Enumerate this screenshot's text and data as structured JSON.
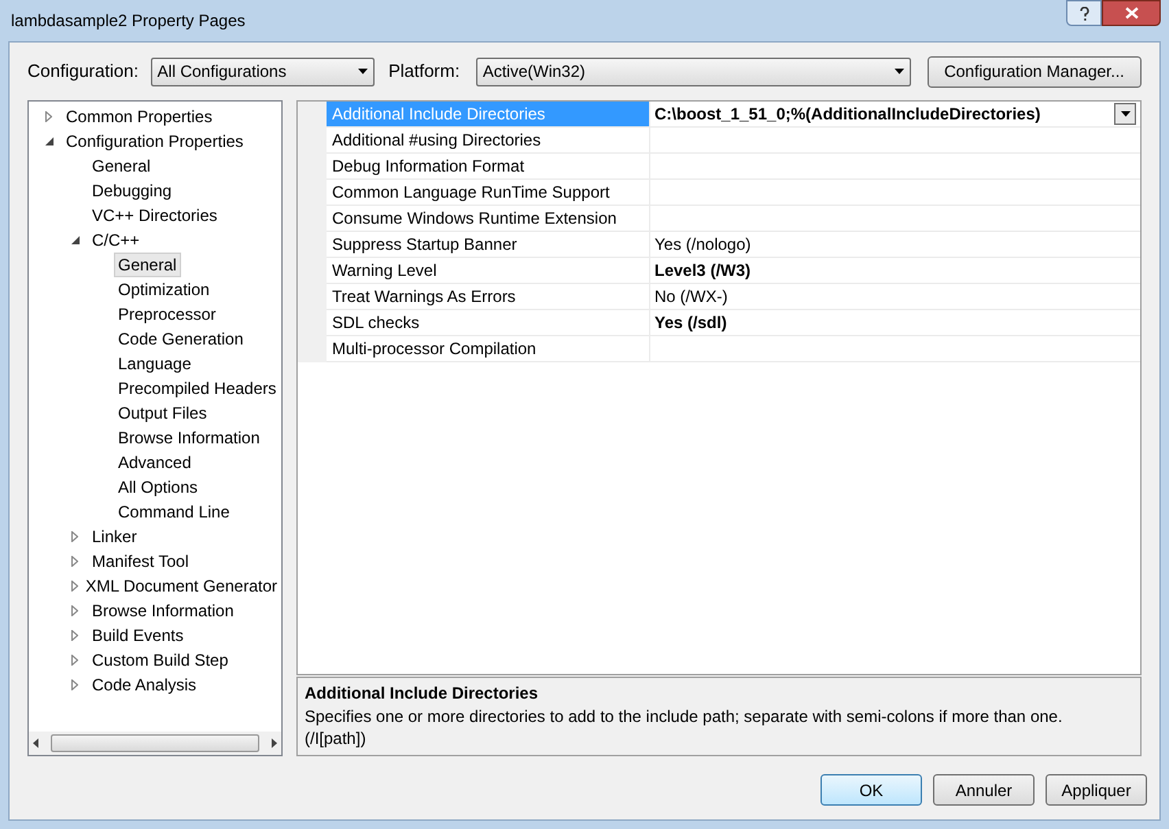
{
  "window": {
    "title": "lambdasample2 Property Pages"
  },
  "configuration": {
    "label": "Configuration:",
    "value": "All Configurations"
  },
  "platform": {
    "label": "Platform:",
    "value": "Active(Win32)"
  },
  "configuration_manager_button": "Configuration Manager...",
  "tree": [
    {
      "label": "Common Properties",
      "expanded": false,
      "selected": false
    },
    {
      "label": "Configuration Properties",
      "expanded": true,
      "selected": false,
      "children": [
        {
          "label": "General",
          "selected": false
        },
        {
          "label": "Debugging",
          "selected": false
        },
        {
          "label": "VC++ Directories",
          "selected": false
        },
        {
          "label": "C/C++",
          "expanded": true,
          "selected": false,
          "children": [
            {
              "label": "General",
              "selected": true
            },
            {
              "label": "Optimization",
              "selected": false
            },
            {
              "label": "Preprocessor",
              "selected": false
            },
            {
              "label": "Code Generation",
              "selected": false
            },
            {
              "label": "Language",
              "selected": false
            },
            {
              "label": "Precompiled Headers",
              "selected": false
            },
            {
              "label": "Output Files",
              "selected": false
            },
            {
              "label": "Browse Information",
              "selected": false
            },
            {
              "label": "Advanced",
              "selected": false
            },
            {
              "label": "All Options",
              "selected": false
            },
            {
              "label": "Command Line",
              "selected": false
            }
          ]
        },
        {
          "label": "Linker",
          "expanded": false,
          "selected": false
        },
        {
          "label": "Manifest Tool",
          "expanded": false,
          "selected": false
        },
        {
          "label": "XML Document Generator",
          "expanded": false,
          "selected": false
        },
        {
          "label": "Browse Information",
          "expanded": false,
          "selected": false
        },
        {
          "label": "Build Events",
          "expanded": false,
          "selected": false
        },
        {
          "label": "Custom Build Step",
          "expanded": false,
          "selected": false
        },
        {
          "label": "Code Analysis",
          "expanded": false,
          "selected": false
        }
      ]
    }
  ],
  "properties": [
    {
      "name": "Additional Include Directories",
      "value": "C:\\boost_1_51_0;%(AdditionalIncludeDirectories)",
      "bold": true,
      "selected": true
    },
    {
      "name": "Additional #using Directories",
      "selected": false
    },
    {
      "name": "Debug Information Format",
      "selected": false
    },
    {
      "name": "Common Language RunTime Support",
      "selected": false
    },
    {
      "name": "Consume Windows Runtime Extension",
      "selected": false
    },
    {
      "name": "Suppress Startup Banner",
      "value": "Yes (/nologo)",
      "bold": false,
      "selected": false
    },
    {
      "name": "Warning Level",
      "value": "Level3 (/W3)",
      "bold": true,
      "selected": false
    },
    {
      "name": "Treat Warnings As Errors",
      "value": "No (/WX-)",
      "bold": false,
      "selected": false
    },
    {
      "name": "SDL checks",
      "value": "Yes (/sdl)",
      "bold": true,
      "selected": false
    },
    {
      "name": "Multi-processor Compilation",
      "selected": false
    }
  ],
  "description": {
    "title": "Additional Include Directories",
    "text": "Specifies one or more directories to add to the include path; separate with semi-colons if more than one. (/I[path])"
  },
  "buttons": [
    {
      "label": "OK",
      "default": true
    },
    {
      "label": "Annuler",
      "default": false
    },
    {
      "label": "Appliquer",
      "default": false
    }
  ]
}
